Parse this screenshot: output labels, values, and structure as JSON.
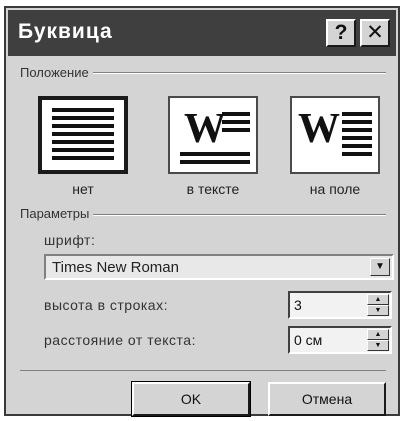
{
  "window": {
    "title": "Буквица",
    "help_label": "?",
    "close_label": "✕"
  },
  "position_group": {
    "label": "Положение",
    "options": [
      {
        "label": "нет",
        "selected": true,
        "icon": "no-dropcap-icon"
      },
      {
        "label": "в тексте",
        "selected": false,
        "icon": "dropcap-in-text-icon"
      },
      {
        "label": "на поле",
        "selected": false,
        "icon": "dropcap-in-margin-icon"
      }
    ],
    "letter": "W"
  },
  "params_group": {
    "label": "Параметры",
    "font_label": "шрифт:",
    "font_value": "Times New Roman",
    "lines_label": "высота в строках:",
    "lines_value": "3",
    "distance_label": "расстояние от текста:",
    "distance_value": "0 см"
  },
  "buttons": {
    "ok": "OK",
    "cancel": "Отмена"
  },
  "colors": {
    "titlebar": "#3f3f3f",
    "dialog_bg": "#d4d4d4"
  }
}
